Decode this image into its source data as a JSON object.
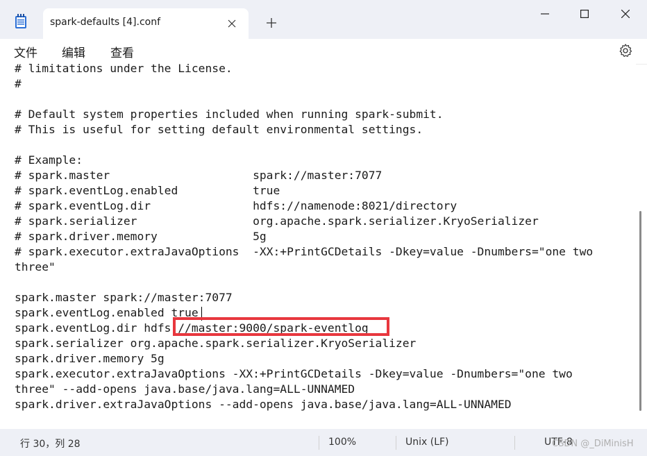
{
  "window": {
    "tab_title": "spark-defaults [4].conf",
    "new_tab_glyph": "+",
    "icons": [
      "notepad-app-icon",
      "close-icon",
      "plus-icon",
      "minimize-icon",
      "maximize-icon",
      "window-close-icon"
    ]
  },
  "menu": {
    "items": [
      "文件",
      "编辑",
      "查看"
    ],
    "settings_icon": "gear-icon"
  },
  "editor": {
    "lines": [
      "# limitations under the License.",
      "#",
      "",
      "# Default system properties included when running spark-submit.",
      "# This is useful for setting default environmental settings.",
      "",
      "# Example:",
      "# spark.master                     spark://master:7077",
      "# spark.eventLog.enabled           true",
      "# spark.eventLog.dir               hdfs://namenode:8021/directory",
      "# spark.serializer                 org.apache.spark.serializer.KryoSerializer",
      "# spark.driver.memory              5g",
      "# spark.executor.extraJavaOptions  -XX:+PrintGCDetails -Dkey=value -Dnumbers=\"one two",
      "three\"",
      "",
      "spark.master spark://master:7077",
      "spark.eventLog.enabled true",
      "spark.eventLog.dir hdfs://master:9000/spark-eventlog",
      "spark.serializer org.apache.spark.serializer.KryoSerializer",
      "spark.driver.memory 5g",
      "spark.executor.extraJavaOptions -XX:+PrintGCDetails -Dkey=value -Dnumbers=\"one two",
      "three\" --add-opens java.base/java.lang=ALL-UNNAMED",
      "spark.driver.extraJavaOptions --add-opens java.base/java.lang=ALL-UNNAMED"
    ],
    "annotation_color": "#e8373e"
  },
  "status": {
    "position": "行 30，列 28",
    "zoom": "100%",
    "line_ending": "Unix (LF)",
    "encoding": "UTF-8",
    "watermark": "CSDN @_DiMinisH"
  }
}
